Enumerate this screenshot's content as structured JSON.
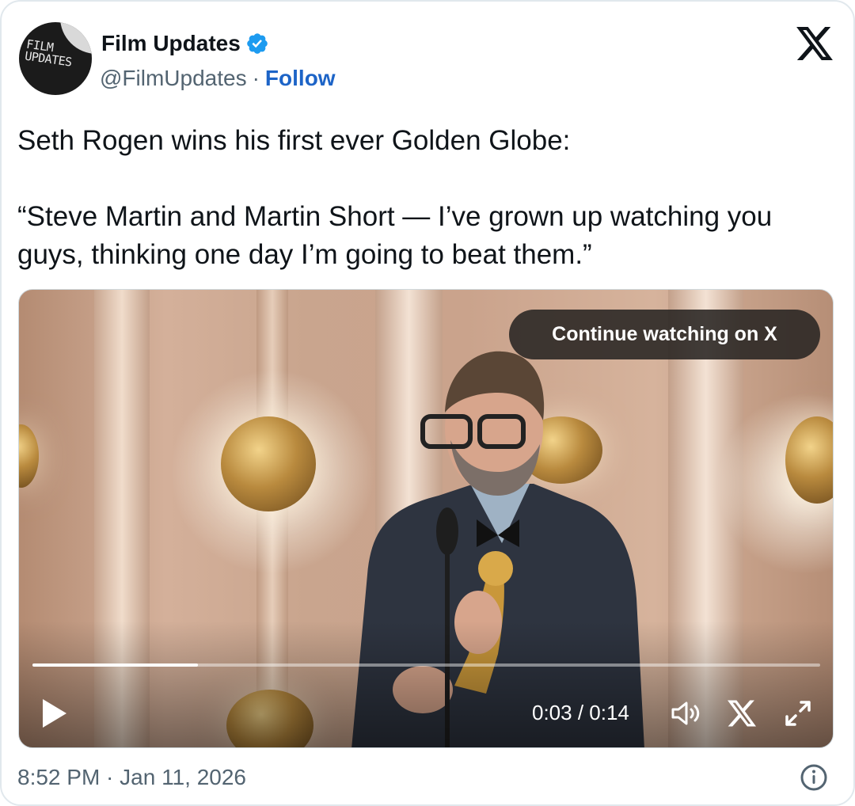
{
  "author": {
    "name": "Film Updates",
    "handle": "@FilmUpdates",
    "separator": "·",
    "follow_label": "Follow",
    "avatar_text": "FILM UPDATES",
    "verified_color": "#1d9bf0"
  },
  "tweet": {
    "text": "Seth Rogen wins his first ever Golden Globe:\n\n“Steve Martin and Martin Short — I’ve grown up watching you guys, thinking one day I’m going to beat them.”"
  },
  "video": {
    "continue_label": "Continue watching on X",
    "current_time": "0:03",
    "time_separator": " / ",
    "duration": "0:14",
    "progress_fraction": 0.21,
    "icons": [
      "play-icon",
      "volume-icon",
      "x-logo-icon",
      "expand-icon"
    ]
  },
  "footer": {
    "timestamp": "8:52 PM · Jan 11, 2026",
    "info_icon": "info-icon"
  },
  "colors": {
    "text": "#0f1419",
    "muted": "#536471",
    "link": "#1d64c7"
  }
}
